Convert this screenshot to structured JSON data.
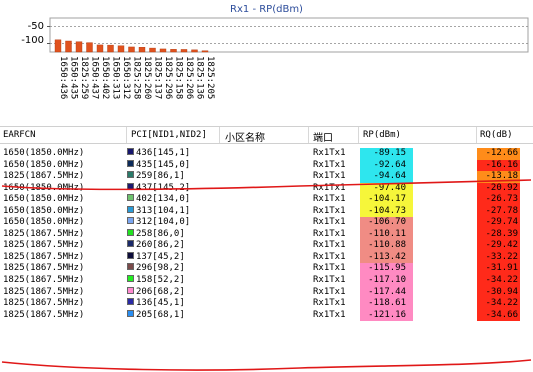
{
  "chart": {
    "title": "Rx1 - RP(dBm)",
    "y_ticks": [
      "-50",
      "-100"
    ]
  },
  "chart_data": {
    "type": "bar",
    "title": "Rx1 - RP(dBm)",
    "xlabel": "",
    "ylabel": "",
    "ylim": [
      -125,
      -25
    ],
    "grid": true,
    "categories": [
      "1650:436",
      "1650:435",
      "1825:259",
      "1650:437",
      "1650:402",
      "1650:313",
      "1650:312",
      "1825:258",
      "1825:260",
      "1825:137",
      "1825:296",
      "1825:158",
      "1825:206",
      "1825:136",
      "1825:205"
    ],
    "values": [
      -89.15,
      -92.64,
      -94.64,
      -97.4,
      -104.17,
      -104.73,
      -106.7,
      -110.11,
      -110.88,
      -113.42,
      -115.95,
      -117.1,
      -117.44,
      -118.61,
      -121.16
    ],
    "bar_color": "#e0521e"
  },
  "table": {
    "headers": {
      "earfcn": "EARFCN",
      "pci": "PCI[NID1,NID2]",
      "cell_name": "小区名称",
      "port": "端口",
      "rp": "RP(dBm)",
      "rq": "RQ(dB)"
    },
    "rows": [
      {
        "earfcn": "1650(1850.0MHz)",
        "pci": "436[145,1]",
        "pci_color": "#16166e",
        "port": "Rx1Tx1",
        "rp": "-89.15",
        "rp_color": "#2ee6ee",
        "rq": "-12.66",
        "rq_color": "#ff8c1a"
      },
      {
        "earfcn": "1650(1850.0MHz)",
        "pci": "435[145,0]",
        "pci_color": "#0b2a5a",
        "port": "Rx1Tx1",
        "rp": "-92.64",
        "rp_color": "#2ee6ee",
        "rq": "-16.16",
        "rq_color": "#ff2a1a"
      },
      {
        "earfcn": "1825(1867.5MHz)",
        "pci": "259[86,1]",
        "pci_color": "#2a7a6a",
        "port": "Rx1Tx1",
        "rp": "-94.64",
        "rp_color": "#2ee6ee",
        "rq": "-13.18",
        "rq_color": "#ff8c1a"
      },
      {
        "earfcn": "1650(1850.0MHz)",
        "pci": "437[145,2]",
        "pci_color": "#1a1a6e",
        "port": "Rx1Tx1",
        "rp": "-97.40",
        "rp_color": "#f6f63a",
        "rq": "-20.92",
        "rq_color": "#ff2a1a"
      },
      {
        "earfcn": "1650(1850.0MHz)",
        "pci": "402[134,0]",
        "pci_color": "#6ec26e",
        "port": "Rx1Tx1",
        "rp": "-104.17",
        "rp_color": "#f6f63a",
        "rq": "-26.73",
        "rq_color": "#ff2a1a"
      },
      {
        "earfcn": "1650(1850.0MHz)",
        "pci": "313[104,1]",
        "pci_color": "#2a9ad6",
        "port": "Rx1Tx1",
        "rp": "-104.73",
        "rp_color": "#f6f63a",
        "rq": "-27.78",
        "rq_color": "#ff2a1a"
      },
      {
        "earfcn": "1650(1850.0MHz)",
        "pci": "312[104,0]",
        "pci_color": "#7aa6f2",
        "port": "Rx1Tx1",
        "rp": "-106.70",
        "rp_color": "#f08c84",
        "rq": "-29.74",
        "rq_color": "#ff2a1a"
      },
      {
        "earfcn": "1825(1867.5MHz)",
        "pci": "258[86,0]",
        "pci_color": "#22e222",
        "port": "Rx1Tx1",
        "rp": "-110.11",
        "rp_color": "#f08c84",
        "rq": "-28.39",
        "rq_color": "#ff2a1a"
      },
      {
        "earfcn": "1825(1867.5MHz)",
        "pci": "260[86,2]",
        "pci_color": "#1a2a6a",
        "port": "Rx1Tx1",
        "rp": "-110.88",
        "rp_color": "#f08c84",
        "rq": "-29.42",
        "rq_color": "#ff2a1a"
      },
      {
        "earfcn": "1825(1867.5MHz)",
        "pci": "137[45,2]",
        "pci_color": "#0c0c3a",
        "port": "Rx1Tx1",
        "rp": "-113.42",
        "rp_color": "#f08c84",
        "rq": "-33.22",
        "rq_color": "#ff2a1a"
      },
      {
        "earfcn": "1825(1867.5MHz)",
        "pci": "296[98,2]",
        "pci_color": "#7a4a4a",
        "port": "Rx1Tx1",
        "rp": "-115.95",
        "rp_color": "#ff8ac2",
        "rq": "-31.91",
        "rq_color": "#ff2a1a"
      },
      {
        "earfcn": "1825(1867.5MHz)",
        "pci": "158[52,2]",
        "pci_color": "#22ee22",
        "port": "Rx1Tx1",
        "rp": "-117.10",
        "rp_color": "#ff8ac2",
        "rq": "-34.22",
        "rq_color": "#ff2a1a"
      },
      {
        "earfcn": "1825(1867.5MHz)",
        "pci": "206[68,2]",
        "pci_color": "#ff8ad0",
        "port": "Rx1Tx1",
        "rp": "-117.44",
        "rp_color": "#ff8ac2",
        "rq": "-30.94",
        "rq_color": "#ff2a1a"
      },
      {
        "earfcn": "1825(1867.5MHz)",
        "pci": "136[45,1]",
        "pci_color": "#2a2aa6",
        "port": "Rx1Tx1",
        "rp": "-118.61",
        "rp_color": "#ff8ac2",
        "rq": "-34.22",
        "rq_color": "#ff2a1a"
      },
      {
        "earfcn": "1825(1867.5MHz)",
        "pci": "205[68,1]",
        "pci_color": "#2a8ef2",
        "port": "Rx1Tx1",
        "rp": "-121.16",
        "rp_color": "#ff8ac2",
        "rq": "-34.66",
        "rq_color": "#ff2a1a"
      }
    ]
  },
  "annotation": {
    "stroke_color": "#e01818"
  }
}
